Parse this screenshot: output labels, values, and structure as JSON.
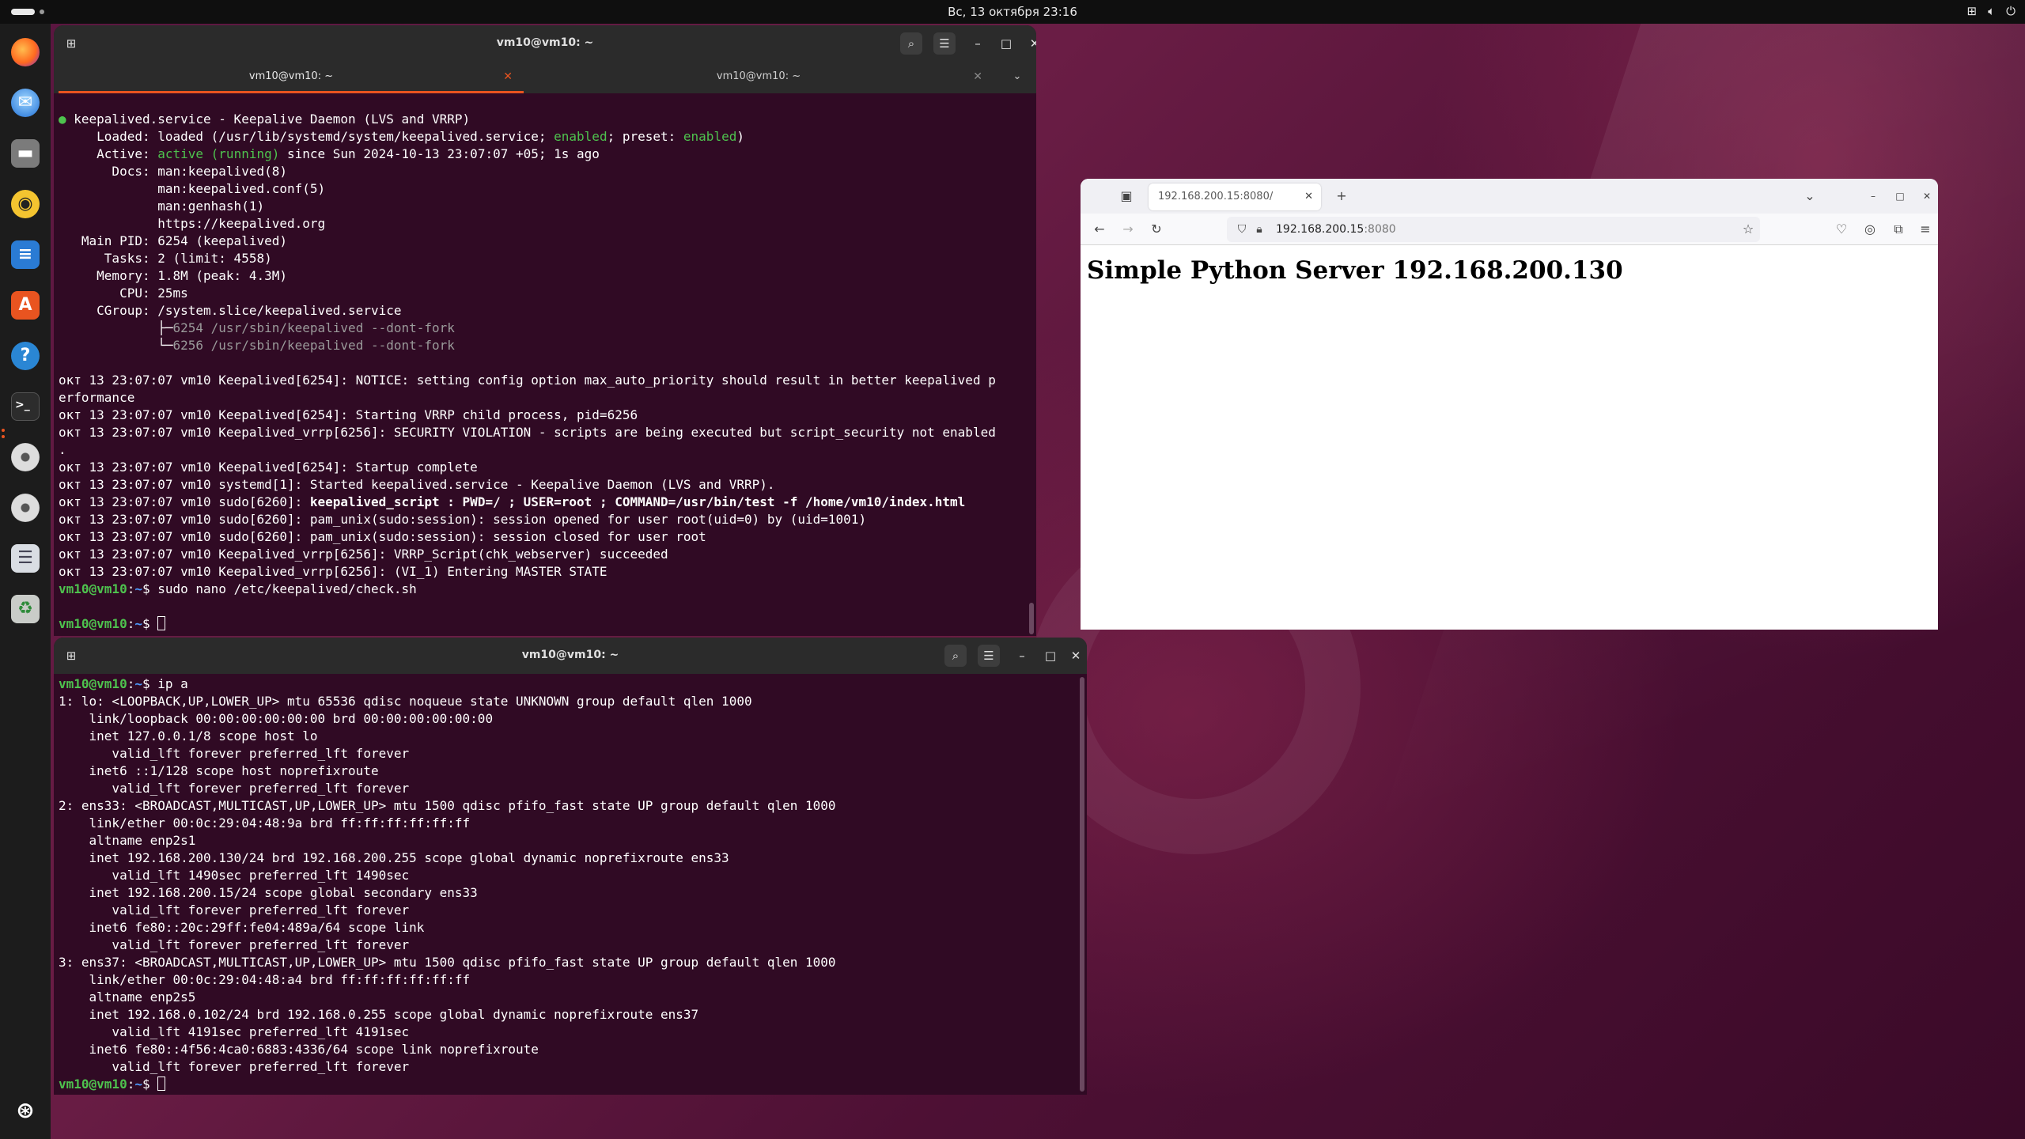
{
  "topbar": {
    "clock": "Вс, 13 октября  23:16",
    "tray_icons": [
      "network-icon",
      "volume-icon",
      "power-icon"
    ]
  },
  "dock": {
    "apps": [
      "firefox-icon",
      "thunderbird-icon",
      "files-icon",
      "rhythmbox-icon",
      "writer-icon",
      "app-center-icon",
      "help-icon",
      "terminal-icon",
      "disc-icon",
      "disc-icon",
      "text-editor-icon",
      "trash-icon"
    ],
    "show_apps": "ubuntu-icon"
  },
  "term1": {
    "title": "vm10@vm10: ~",
    "tabs": [
      {
        "label": "vm10@vm10: ~"
      },
      {
        "label": "vm10@vm10: ~"
      }
    ],
    "lines": [
      [
        {
          "t": "● ",
          "c": "g"
        },
        {
          "t": "keepalived.service - Keepalive Daemon (LVS and VRRP)"
        }
      ],
      [
        {
          "t": "     Loaded: loaded (/usr/lib/systemd/system/keepalived.service; "
        },
        {
          "t": "enabled",
          "c": "g"
        },
        {
          "t": "; preset: "
        },
        {
          "t": "enabled",
          "c": "g"
        },
        {
          "t": ")"
        }
      ],
      [
        {
          "t": "     Active: "
        },
        {
          "t": "active (running)",
          "c": "g"
        },
        {
          "t": " since Sun 2024-10-13 23:07:07 +05; 1s ago"
        }
      ],
      [
        {
          "t": "       Docs: man:keepalived(8)"
        }
      ],
      [
        {
          "t": "             man:keepalived.conf(5)"
        }
      ],
      [
        {
          "t": "             man:genhash(1)"
        }
      ],
      [
        {
          "t": "             https://keepalived.org"
        }
      ],
      [
        {
          "t": "   Main PID: 6254 (keepalived)"
        }
      ],
      [
        {
          "t": "      Tasks: 2 (limit: 4558)"
        }
      ],
      [
        {
          "t": "     Memory: 1.8M (peak: 4.3M)"
        }
      ],
      [
        {
          "t": "        CPU: 25ms"
        }
      ],
      [
        {
          "t": "     CGroup: /system.slice/keepalived.service"
        }
      ],
      [
        {
          "t": "             ├─"
        },
        {
          "t": "6254 /usr/sbin/keepalived --dont-fork",
          "c": "dim"
        }
      ],
      [
        {
          "t": "             └─"
        },
        {
          "t": "6256 /usr/sbin/keepalived --dont-fork",
          "c": "dim"
        }
      ],
      [
        {
          "t": ""
        }
      ],
      [
        {
          "t": "окт 13 23:07:07 vm10 Keepalived[6254]: NOTICE: setting config option max_auto_priority should result in better keepalived p"
        }
      ],
      [
        {
          "t": "erformance"
        }
      ],
      [
        {
          "t": "окт 13 23:07:07 vm10 Keepalived[6254]: Starting VRRP child process, pid=6256"
        }
      ],
      [
        {
          "t": "окт 13 23:07:07 vm10 Keepalived_vrrp[6256]: SECURITY VIOLATION - scripts are being executed but script_security not enabled"
        }
      ],
      [
        {
          "t": "."
        }
      ],
      [
        {
          "t": "окт 13 23:07:07 vm10 Keepalived[6254]: Startup complete"
        }
      ],
      [
        {
          "t": "окт 13 23:07:07 vm10 systemd[1]: Started keepalived.service - Keepalive Daemon (LVS and VRRP)."
        }
      ],
      [
        {
          "t": "окт 13 23:07:07 vm10 sudo[6260]: "
        },
        {
          "t": "keepalived_script : PWD=/ ; USER=root ; COMMAND=/usr/bin/test -f /home/vm10/index.html",
          "c": "bold"
        }
      ],
      [
        {
          "t": "окт 13 23:07:07 vm10 sudo[6260]: pam_unix(sudo:session): session opened for user root(uid=0) by (uid=1001)"
        }
      ],
      [
        {
          "t": "окт 13 23:07:07 vm10 sudo[6260]: pam_unix(sudo:session): session closed for user root"
        }
      ],
      [
        {
          "t": "окт 13 23:07:07 vm10 Keepalived_vrrp[6256]: VRRP_Script(chk_webserver) succeeded"
        }
      ],
      [
        {
          "t": "окт 13 23:07:07 vm10 Keepalived_vrrp[6256]: (VI_1) Entering MASTER STATE"
        }
      ],
      [
        {
          "t": "vm10@vm10",
          "c": "prompt-user"
        },
        {
          "t": ":"
        },
        {
          "t": "~",
          "c": "prompt-path"
        },
        {
          "t": "$ sudo nano /etc/keepalived/check.sh"
        }
      ],
      [
        {
          "t": ""
        }
      ],
      [
        {
          "t": "vm10@vm10",
          "c": "prompt-user"
        },
        {
          "t": ":"
        },
        {
          "t": "~",
          "c": "prompt-path"
        },
        {
          "t": "$ "
        },
        {
          "t": "",
          "c": "cursor"
        }
      ]
    ]
  },
  "term2": {
    "title": "vm10@vm10: ~",
    "lines": [
      [
        {
          "t": "vm10@vm10",
          "c": "prompt-user"
        },
        {
          "t": ":"
        },
        {
          "t": "~",
          "c": "prompt-path"
        },
        {
          "t": "$ ip a"
        }
      ],
      [
        {
          "t": "1: lo: <LOOPBACK,UP,LOWER_UP> mtu 65536 qdisc noqueue state UNKNOWN group default qlen 1000"
        }
      ],
      [
        {
          "t": "    link/loopback 00:00:00:00:00:00 brd 00:00:00:00:00:00"
        }
      ],
      [
        {
          "t": "    inet 127.0.0.1/8 scope host lo"
        }
      ],
      [
        {
          "t": "       valid_lft forever preferred_lft forever"
        }
      ],
      [
        {
          "t": "    inet6 ::1/128 scope host noprefixroute"
        }
      ],
      [
        {
          "t": "       valid_lft forever preferred_lft forever"
        }
      ],
      [
        {
          "t": "2: ens33: <BROADCAST,MULTICAST,UP,LOWER_UP> mtu 1500 qdisc pfifo_fast state UP group default qlen 1000"
        }
      ],
      [
        {
          "t": "    link/ether 00:0c:29:04:48:9a brd ff:ff:ff:ff:ff:ff"
        }
      ],
      [
        {
          "t": "    altname enp2s1"
        }
      ],
      [
        {
          "t": "    inet 192.168.200.130/24 brd 192.168.200.255 scope global dynamic noprefixroute ens33"
        }
      ],
      [
        {
          "t": "       valid_lft 1490sec preferred_lft 1490sec"
        }
      ],
      [
        {
          "t": "    inet 192.168.200.15/24 scope global secondary ens33"
        }
      ],
      [
        {
          "t": "       valid_lft forever preferred_lft forever"
        }
      ],
      [
        {
          "t": "    inet6 fe80::20c:29ff:fe04:489a/64 scope link"
        }
      ],
      [
        {
          "t": "       valid_lft forever preferred_lft forever"
        }
      ],
      [
        {
          "t": "3: ens37: <BROADCAST,MULTICAST,UP,LOWER_UP> mtu 1500 qdisc pfifo_fast state UP group default qlen 1000"
        }
      ],
      [
        {
          "t": "    link/ether 00:0c:29:04:48:a4 brd ff:ff:ff:ff:ff:ff"
        }
      ],
      [
        {
          "t": "    altname enp2s5"
        }
      ],
      [
        {
          "t": "    inet 192.168.0.102/24 brd 192.168.0.255 scope global dynamic noprefixroute ens37"
        }
      ],
      [
        {
          "t": "       valid_lft 4191sec preferred_lft 4191sec"
        }
      ],
      [
        {
          "t": "    inet6 fe80::4f56:4ca0:6883:4336/64 scope link noprefixroute"
        }
      ],
      [
        {
          "t": "       valid_lft forever preferred_lft forever"
        }
      ],
      [
        {
          "t": "vm10@vm10",
          "c": "prompt-user"
        },
        {
          "t": ":"
        },
        {
          "t": "~",
          "c": "prompt-path"
        },
        {
          "t": "$ "
        },
        {
          "t": "",
          "c": "cursor"
        }
      ]
    ]
  },
  "browser": {
    "tab_label": "192.168.200.15:8080/",
    "url_host": "192.168.200.15",
    "url_port": ":8080",
    "heading": "Simple Python Server 192.168.200.130"
  },
  "colors": {
    "terminal_bg": "#300a24",
    "accent": "#e95420",
    "prompt_green": "#4ec24e",
    "prompt_blue": "#4d9cff"
  }
}
